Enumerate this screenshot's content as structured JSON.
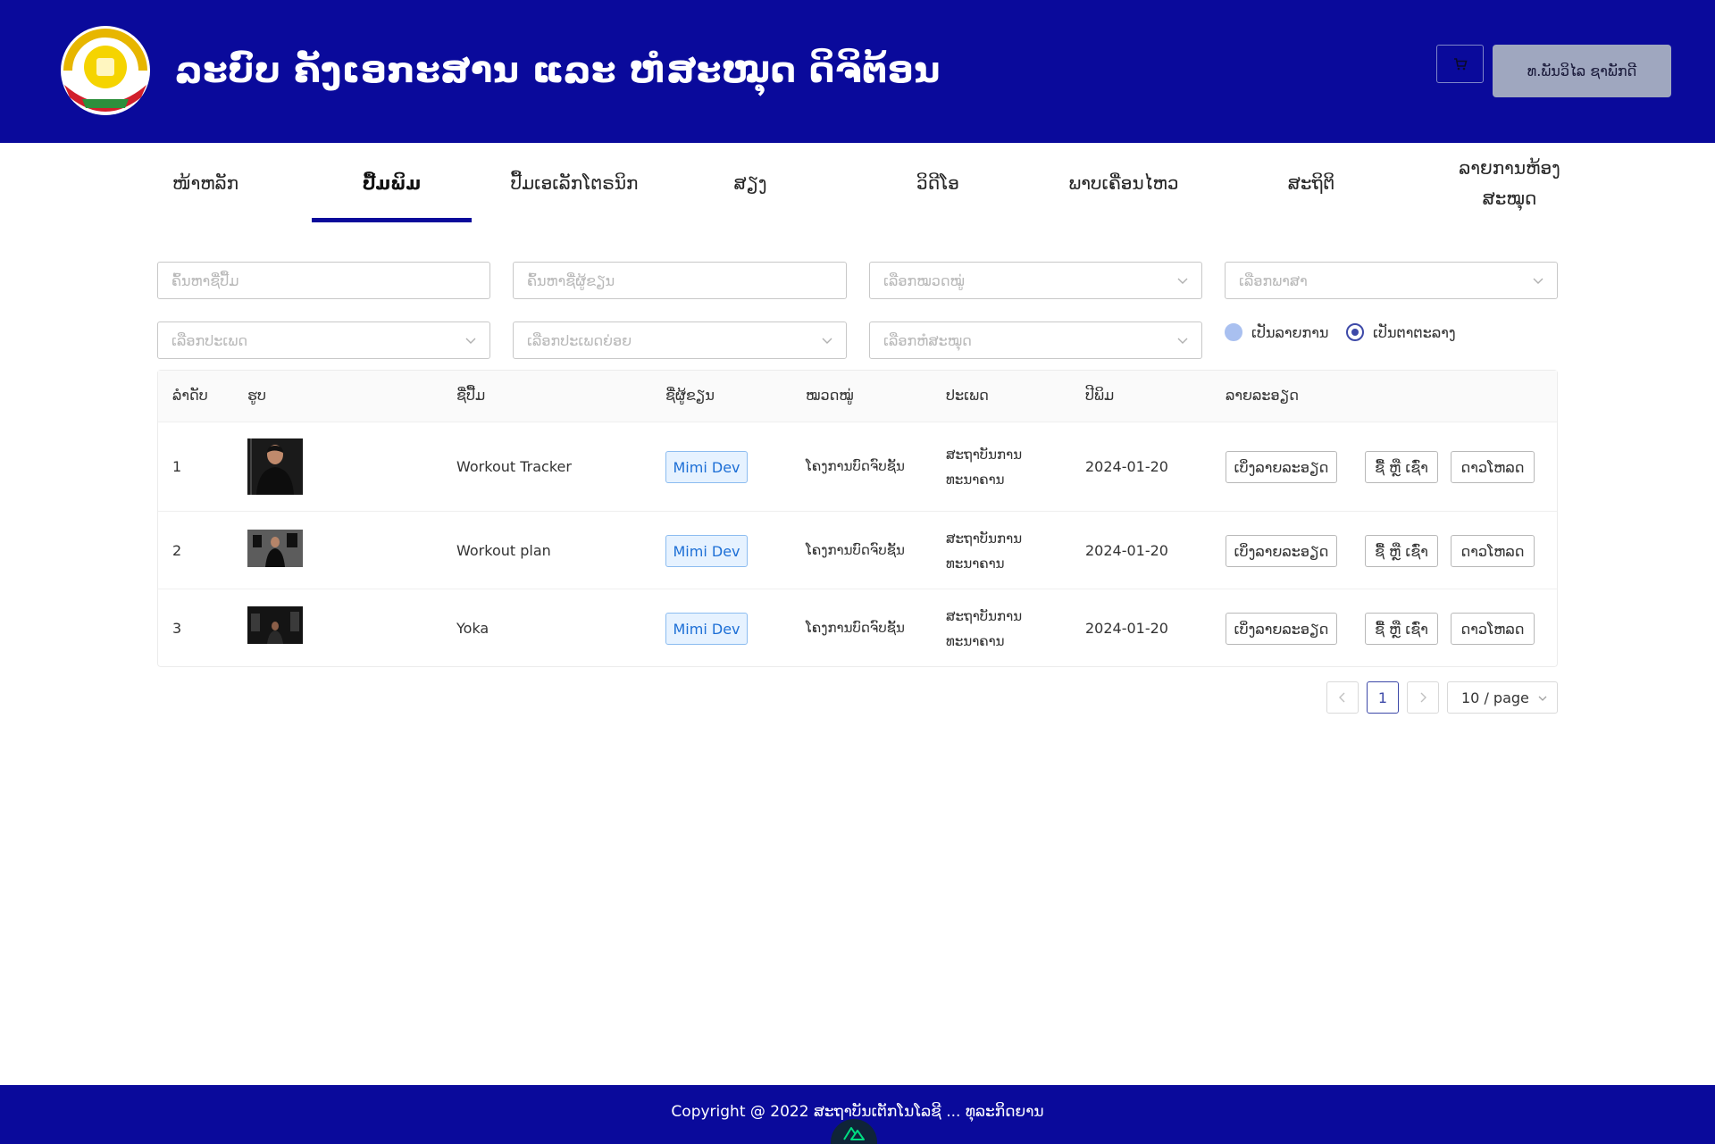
{
  "header": {
    "title": "ລະບົບ ຄັງເອກະສານ ແລະ ຫໍສະໝຸດ ດິຈິຕ້ອນ",
    "logo_icon": "government-emblem-icon",
    "cart_icon": "shopping-cart-icon",
    "user_label": "ທ.ພັນວິໄລ ຊາພັກດີ"
  },
  "nav": {
    "items": [
      {
        "label": "ໜ້າຫລັກ"
      },
      {
        "label": "ປື້ມພິມ"
      },
      {
        "label": "ປື້ມເອເລັກໂຕຣນິກ"
      },
      {
        "label": "ສຽງ"
      },
      {
        "label": "ວິດີໂອ"
      },
      {
        "label": "ພາບເຄື່ອນໄຫວ"
      },
      {
        "label": "ສະຖິຕິ"
      },
      {
        "label": "ລາຍການຫ້ອງ ສະໝຸດ"
      }
    ],
    "active_index": 1
  },
  "filters": {
    "book_name_placeholder": "ຄົ້ນຫາຊື່ປື້ມ",
    "author_placeholder": "ຄົ້ນຫາຊື່ຜູ້ຂຽນ",
    "category_placeholder": "ເລືອກໝວດໝູ່",
    "language_placeholder": "ເລືອກພາສາ",
    "type_placeholder": "ເລືອກປະເພດ",
    "subtype_placeholder": "ເລືອກປະເພດຍ່ອຍ",
    "library_placeholder": "ເລືອກຫໍສະໝຸດ",
    "view_list_label": "ເປັນລາຍການ",
    "view_grid_label": "ເປັນຕາຕະລາງ",
    "selected_view": "grid"
  },
  "table": {
    "columns": [
      "ລຳດັບ",
      "ຮູບ",
      "ຊື່ປື້ມ",
      "ຊື່ຜູ້ຂຽນ",
      "ໝວດໝູ່",
      "ປະເພດ",
      "ປີພິມ",
      "ລາຍລະອຽດ"
    ],
    "rows": [
      {
        "index": "1",
        "title": "Workout Tracker",
        "author": "Mimi Dev",
        "category": "ໂຄງການບົດຈົບຊັ້ນ",
        "type_line1": "ສະຖາບັນການ",
        "type_line2": "ທະນາຄານ",
        "year": "2024-01-20",
        "detail_btn": "ເບິ່ງລາຍລະອຽດ",
        "borrow_btn": "ຊື້ ຫຼື ເຊົ່າ",
        "download_btn": "ດາວໂຫລດ"
      },
      {
        "index": "2",
        "title": "Workout plan",
        "author": "Mimi Dev",
        "category": "ໂຄງການບົດຈົບຊັ້ນ",
        "type_line1": "ສະຖາບັນການ",
        "type_line2": "ທະນາຄານ",
        "year": "2024-01-20",
        "detail_btn": "ເບິ່ງລາຍລະອຽດ",
        "borrow_btn": "ຊື້ ຫຼື ເຊົ່າ",
        "download_btn": "ດາວໂຫລດ"
      },
      {
        "index": "3",
        "title": "Yoka",
        "author": "Mimi Dev",
        "category": "ໂຄງການບົດຈົບຊັ້ນ",
        "type_line1": "ສະຖາບັນການ",
        "type_line2": "ທະນາຄານ",
        "year": "2024-01-20",
        "detail_btn": "ເບິ່ງລາຍລະອຽດ",
        "borrow_btn": "ຊື້ ຫຼື ເຊົ່າ",
        "download_btn": "ດາວໂຫລດ"
      }
    ]
  },
  "pagination": {
    "current_page": "1",
    "page_size": "10 / page"
  },
  "footer": {
    "copyright": "Copyright @ 2022 ສະຖາບັນເຕັກໂນໂລຊີ ... ທຸລະກິດຍານ"
  },
  "colors": {
    "brand": "#0a0a9b",
    "accent": "#3d49a8",
    "tag_text": "#1d6fd6",
    "user_button": "#9fa7bf"
  }
}
